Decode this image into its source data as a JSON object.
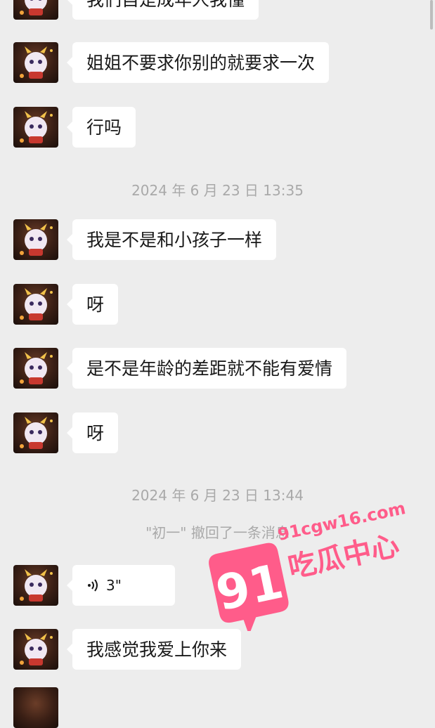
{
  "messages": [
    {
      "text": "我们自是成年人我懂"
    },
    {
      "text": "姐姐不要求你别的就要求一次"
    },
    {
      "text": "行吗"
    },
    {
      "text": "我是不是和小孩子一样"
    },
    {
      "text": "呀"
    },
    {
      "text": "是不是年龄的差距就不能有爱情"
    },
    {
      "text": "呀"
    },
    {
      "voice_duration": "3\""
    },
    {
      "text": "我感觉我爱上你来"
    }
  ],
  "timestamps": [
    "2024 年 6 月 23 日 13:35",
    "2024 年 6 月 23 日 13:44"
  ],
  "system_notice": "\"初一\" 撤回了一条消息",
  "watermark": {
    "number": "91",
    "domain": "91cgw16.com",
    "brand": "吃瓜中心",
    "color": "#ff5c8a"
  },
  "icons": {
    "avatar": "dragon-avatar",
    "voice": "voice-wave-icon"
  }
}
